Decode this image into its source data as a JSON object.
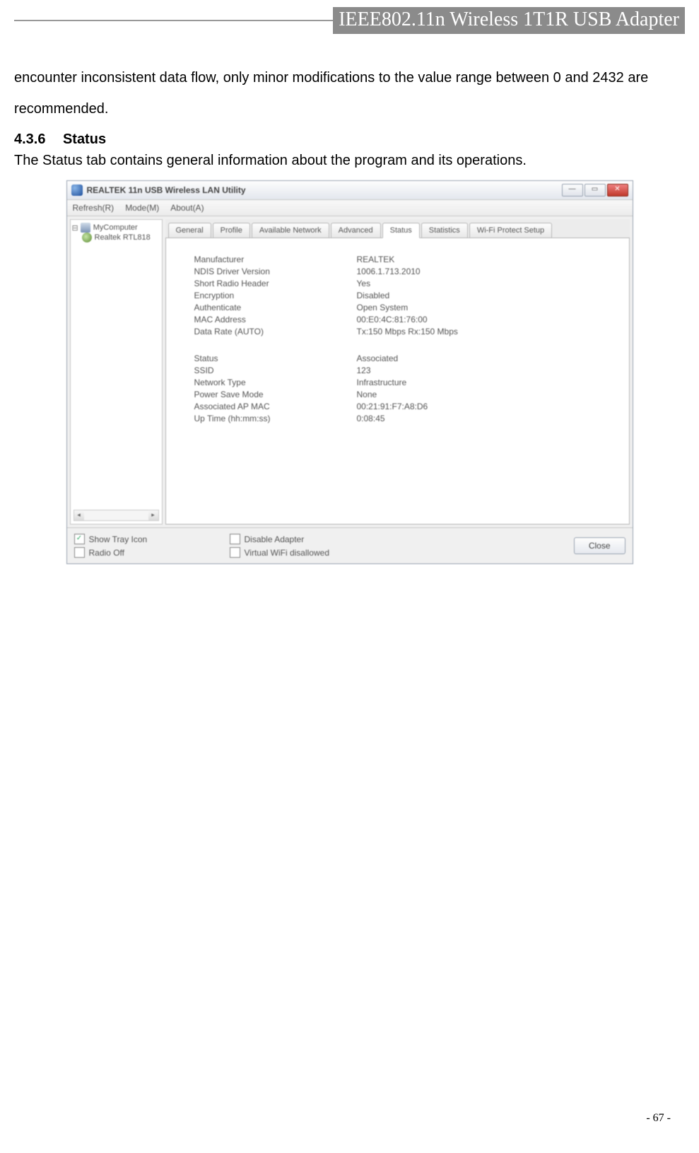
{
  "header": {
    "title": "IEEE802.11n Wireless 1T1R USB Adapter"
  },
  "body": {
    "para1": "encounter inconsistent data flow, only minor modifications to the value range between 0 and 2432 are recommended.",
    "section_num": "4.3.6",
    "section_title": "Status",
    "para2": "The Status tab contains general information about the program and its operations."
  },
  "shot": {
    "window_title": "REALTEK 11n USB Wireless LAN Utility",
    "menus": [
      "Refresh(R)",
      "Mode(M)",
      "About(A)"
    ],
    "tree": {
      "root": "MyComputer",
      "child": "Realtek RTL818"
    },
    "tabs": [
      "General",
      "Profile",
      "Available Network",
      "Advanced",
      "Status",
      "Statistics",
      "Wi-Fi Protect Setup"
    ],
    "status_top": [
      {
        "k": "Manufacturer",
        "v": "REALTEK"
      },
      {
        "k": "NDIS Driver Version",
        "v": "1006.1.713.2010"
      },
      {
        "k": "Short Radio Header",
        "v": "Yes"
      },
      {
        "k": "Encryption",
        "v": "Disabled"
      },
      {
        "k": "Authenticate",
        "v": "Open System"
      },
      {
        "k": "MAC Address",
        "v": "00:E0:4C:81:76:00"
      },
      {
        "k": "Data Rate (AUTO)",
        "v": "Tx:150 Mbps Rx:150 Mbps"
      }
    ],
    "status_bottom": [
      {
        "k": "Status",
        "v": "Associated"
      },
      {
        "k": "SSID",
        "v": "123"
      },
      {
        "k": "Network Type",
        "v": "Infrastructure"
      },
      {
        "k": "Power Save Mode",
        "v": "None"
      },
      {
        "k": "Associated AP MAC",
        "v": "00:21:91:F7:A8:D6"
      },
      {
        "k": "Up Time (hh:mm:ss)",
        "v": "0:08:45"
      }
    ],
    "checks": {
      "tray": "Show Tray Icon",
      "radio": "Radio Off",
      "disable": "Disable Adapter",
      "virtual": "Virtual WiFi disallowed"
    },
    "close": "Close"
  },
  "page_number": "- 67 -"
}
